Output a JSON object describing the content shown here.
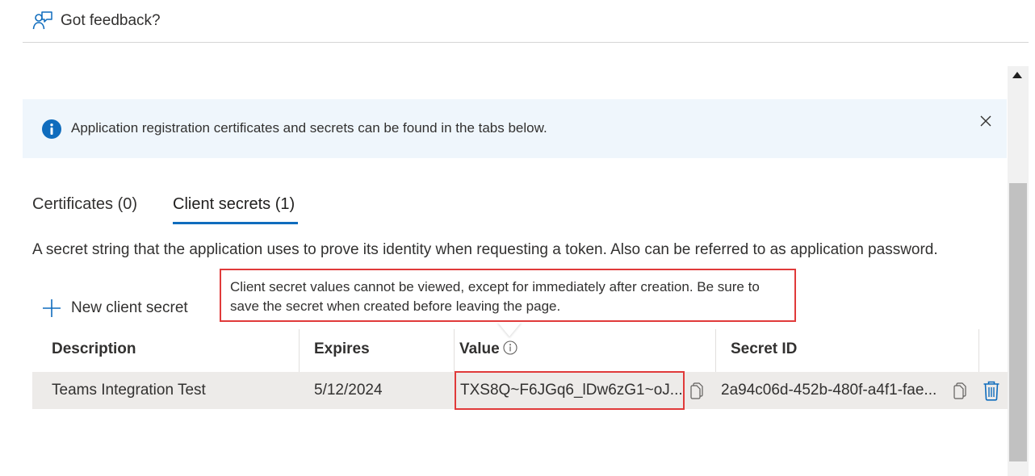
{
  "header": {
    "feedback_label": "Got feedback?"
  },
  "banner": {
    "message": "Application registration certificates and secrets can be found in the tabs below."
  },
  "tabs": [
    {
      "label": "Certificates (0)",
      "selected": false
    },
    {
      "label": "Client secrets (1)",
      "selected": true
    }
  ],
  "description": "A secret string that the application uses to prove its identity when requesting a token. Also can be referred to as application password.",
  "toolbar": {
    "new_secret_label": "New client secret"
  },
  "tooltip": {
    "text": "Client secret values cannot be viewed, except for immediately after creation. Be sure to save the secret when created before leaving the page."
  },
  "table": {
    "columns": [
      "Description",
      "Expires",
      "Value",
      "Secret ID"
    ],
    "rows": [
      {
        "description": "Teams Integration Test",
        "expires": "5/12/2024",
        "value": "TXS8Q~F6JGq6_lDw6zG1~oJ...",
        "secret_id": "2a94c06d-452b-480f-a4f1-fae..."
      }
    ]
  },
  "colors": {
    "accent": "#0f6cbd",
    "highlight_border": "#e03a3a",
    "banner_bg": "#eff6fc",
    "row_bg": "#edebe9"
  }
}
